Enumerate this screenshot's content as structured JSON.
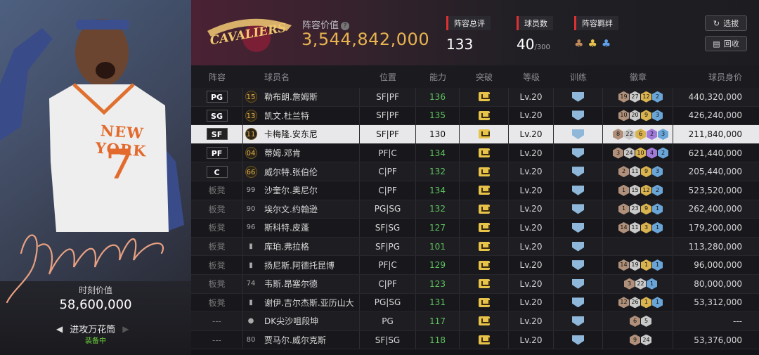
{
  "left_panel": {
    "moment_value_label": "时刻价值",
    "moment_value": "58,600,000",
    "tactic_name": "进攻万花筒",
    "equipped_label": "装备中",
    "jersey_text": "NEW YORK",
    "jersey_number": "7"
  },
  "header": {
    "team_logo_text": "CAVALIERS",
    "lineup_value_label": "阵容价值",
    "lineup_value": "3,544,842,000",
    "overall_label": "阵容总评",
    "overall_value": "133",
    "roster_label": "球员数",
    "roster_value": "40",
    "roster_max": "/300",
    "bond_label": "阵容羁绊",
    "select_button": "选拔",
    "return_button": "回收"
  },
  "columns": [
    "阵容",
    "球员名",
    "位置",
    "能力",
    "突破",
    "等级",
    "训练",
    "徽章",
    "球员身价"
  ],
  "rows": [
    {
      "slot": "PG",
      "starter": true,
      "num": "15",
      "num_style": "gold",
      "name": "勒布朗.詹姆斯",
      "pos": "SF|PF",
      "ability": "136",
      "level": "Lv.20",
      "badges": [
        [
          "b",
          "19"
        ],
        [
          "s",
          "27"
        ],
        [
          "g",
          "12"
        ],
        [
          "bl",
          "2"
        ]
      ],
      "value": "440,320,000"
    },
    {
      "slot": "SG",
      "starter": true,
      "num": "13",
      "num_style": "gold",
      "name": "凯文.杜兰特",
      "pos": "SF|PF",
      "ability": "135",
      "level": "Lv.20",
      "badges": [
        [
          "b",
          "10"
        ],
        [
          "s",
          "20"
        ],
        [
          "g",
          "9"
        ],
        [
          "bl",
          "3"
        ]
      ],
      "value": "426,240,000"
    },
    {
      "slot": "SF",
      "starter": true,
      "selected": true,
      "num": "11",
      "num_style": "gold",
      "name": "卡梅隆.安东尼",
      "pos": "SF|PF",
      "ability": "130",
      "level": "Lv.20",
      "badges": [
        [
          "b",
          "8"
        ],
        [
          "s",
          "22"
        ],
        [
          "g",
          "6"
        ],
        [
          "p",
          "2"
        ],
        [
          "bl",
          "3"
        ]
      ],
      "value": "211,840,000"
    },
    {
      "slot": "PF",
      "starter": true,
      "num": "04",
      "num_style": "gold",
      "name": "蒂姆.邓肯",
      "pos": "PF|C",
      "ability": "134",
      "level": "Lv.20",
      "badges": [
        [
          "b",
          "3"
        ],
        [
          "s",
          "24"
        ],
        [
          "g",
          "10"
        ],
        [
          "p",
          "4"
        ],
        [
          "bl",
          "2"
        ]
      ],
      "value": "621,440,000"
    },
    {
      "slot": "C",
      "starter": true,
      "num": "66",
      "num_style": "gold",
      "name": "威尔特.张伯伦",
      "pos": "C|PF",
      "ability": "132",
      "level": "Lv.20",
      "badges": [
        [
          "b",
          "2"
        ],
        [
          "s",
          "11"
        ],
        [
          "g",
          "9"
        ],
        [
          "bl",
          "3"
        ]
      ],
      "value": "205,440,000"
    },
    {
      "slot": "板凳",
      "starter": false,
      "num": "99",
      "num_style": "plain",
      "name": "沙奎尔.奥尼尔",
      "pos": "C|PF",
      "ability": "134",
      "level": "Lv.20",
      "badges": [
        [
          "b",
          "1"
        ],
        [
          "s",
          "15"
        ],
        [
          "g",
          "12"
        ],
        [
          "bl",
          "2"
        ]
      ],
      "value": "523,520,000"
    },
    {
      "slot": "板凳",
      "starter": false,
      "num": "90",
      "num_style": "plain",
      "name": "埃尔文.约翰逊",
      "pos": "PG|SG",
      "ability": "132",
      "level": "Lv.20",
      "badges": [
        [
          "b",
          "1"
        ],
        [
          "s",
          "23"
        ],
        [
          "g",
          "9"
        ],
        [
          "bl",
          "1"
        ]
      ],
      "value": "262,400,000"
    },
    {
      "slot": "板凳",
      "starter": false,
      "num": "96",
      "num_style": "plain",
      "name": "斯科特.皮蓬",
      "pos": "SF|SG",
      "ability": "127",
      "level": "Lv.20",
      "badges": [
        [
          "b",
          "14"
        ],
        [
          "s",
          "11"
        ],
        [
          "g",
          "3"
        ],
        [
          "bl",
          "1"
        ]
      ],
      "value": "179,200,000"
    },
    {
      "slot": "板凳",
      "starter": false,
      "num": "▮",
      "num_style": "plain",
      "name": "库珀.弗拉格",
      "pos": "SF|PG",
      "ability": "101",
      "level": "Lv.20",
      "badges": [],
      "value": "113,280,000"
    },
    {
      "slot": "板凳",
      "starter": false,
      "num": "▮",
      "num_style": "plain",
      "name": "扬尼斯.阿德托昆博",
      "pos": "PF|C",
      "ability": "129",
      "level": "Lv.20",
      "badges": [
        [
          "b",
          "14"
        ],
        [
          "s",
          "19"
        ],
        [
          "g",
          "1"
        ],
        [
          "bl",
          "1"
        ]
      ],
      "value": "96,000,000"
    },
    {
      "slot": "板凳",
      "starter": false,
      "num": "74",
      "num_style": "plain",
      "name": "韦斯.昂塞尔德",
      "pos": "C|PF",
      "ability": "123",
      "level": "Lv.20",
      "badges": [
        [
          "b",
          "3"
        ],
        [
          "s",
          "22"
        ],
        [
          "bl",
          "1"
        ]
      ],
      "value": "80,000,000"
    },
    {
      "slot": "板凳",
      "starter": false,
      "num": "▮",
      "num_style": "plain",
      "name": "谢伊.吉尔杰斯.亚历山大",
      "pos": "PG|SG",
      "ability": "131",
      "level": "Lv.20",
      "badges": [
        [
          "b",
          "12"
        ],
        [
          "s",
          "26"
        ],
        [
          "g",
          "1"
        ],
        [
          "bl",
          "1"
        ]
      ],
      "value": "53,312,000"
    },
    {
      "slot": "---",
      "starter": false,
      "num": "●",
      "num_style": "plain",
      "name": "DK尖沙咀段坤",
      "pos": "PG",
      "ability": "117",
      "level": "Lv.20",
      "badges": [
        [
          "b",
          "6"
        ],
        [
          "s",
          "5"
        ]
      ],
      "value": "---"
    },
    {
      "slot": "---",
      "starter": false,
      "num": "80",
      "num_style": "plain",
      "name": "贾马尔.威尔克斯",
      "pos": "SF|SG",
      "ability": "118",
      "level": "Lv.20",
      "badges": [
        [
          "b",
          "9"
        ],
        [
          "s",
          "24"
        ]
      ],
      "value": "53,376,000"
    }
  ]
}
